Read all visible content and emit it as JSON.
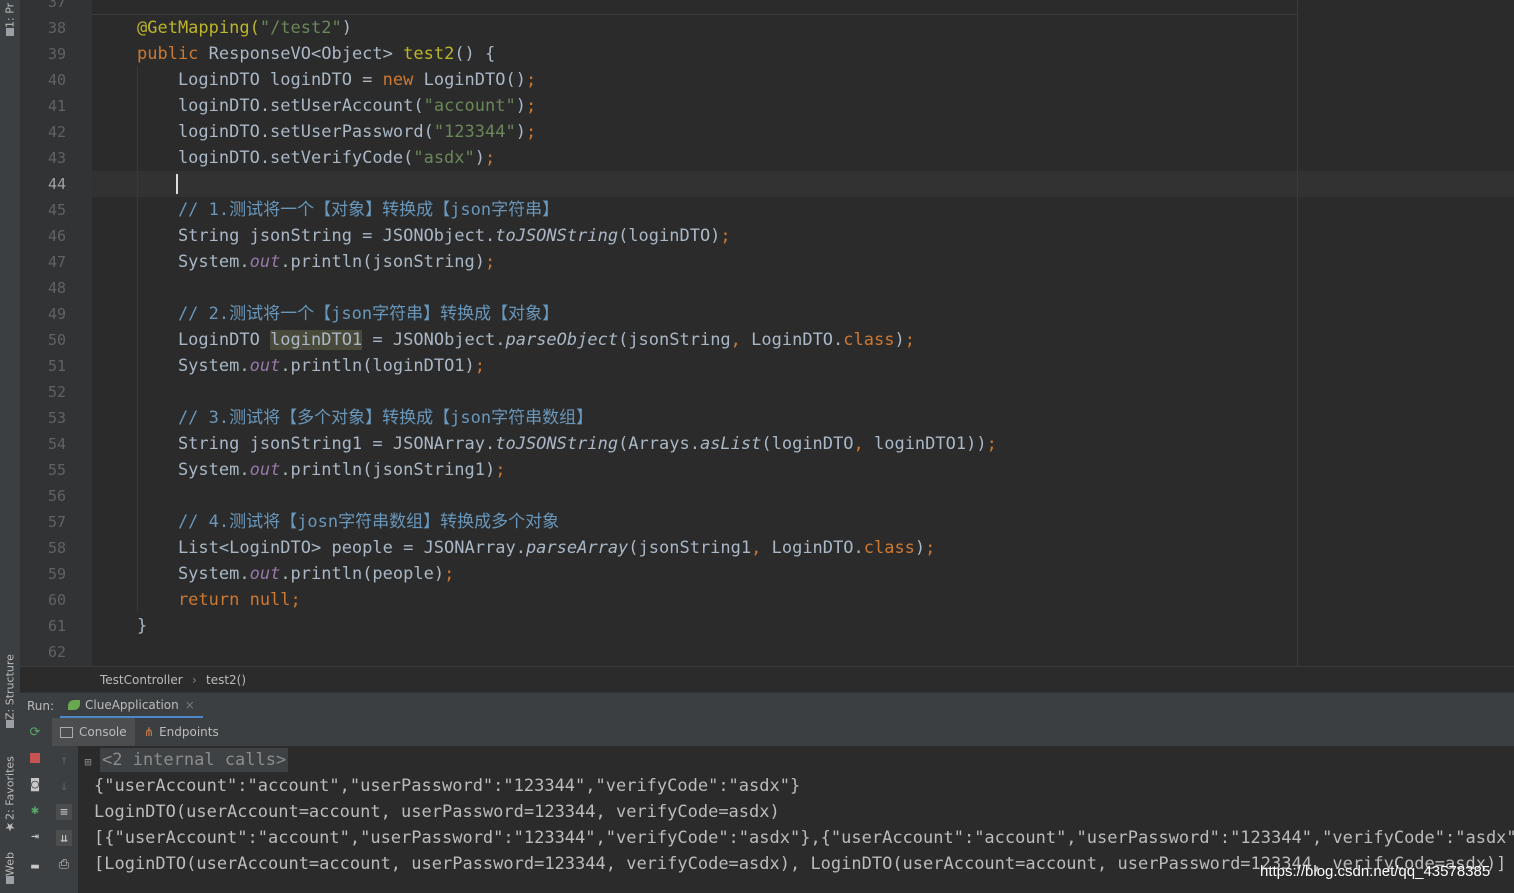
{
  "left_strip": {
    "project_tab": "1: Pr",
    "structure_tab": "Z: Structure",
    "favorites_tab": "2: Favorites",
    "web_tab": "Web"
  },
  "editor": {
    "first_line_number": 37,
    "current_line": 44,
    "line_numbers": [
      "37",
      "38",
      "39",
      "40",
      "41",
      "42",
      "43",
      "44",
      "45",
      "46",
      "47",
      "48",
      "49",
      "50",
      "51",
      "52",
      "53",
      "54",
      "55",
      "56",
      "57",
      "58",
      "59",
      "60",
      "61",
      "62"
    ],
    "code": {
      "l38": {
        "a": "@GetMapping(",
        "b": "\"/test2\"",
        "c": ")"
      },
      "l39": {
        "a": "public ",
        "b": "ResponseVO<Object> ",
        "c": "test2",
        "d": "() {"
      },
      "l40": {
        "a": "    LoginDTO loginDTO = ",
        "b": "new ",
        "c": "LoginDTO()",
        "d": ";"
      },
      "l41": {
        "a": "    loginDTO.setUserAccount(",
        "b": "\"account\"",
        "c": ")",
        "d": ";"
      },
      "l42": {
        "a": "    loginDTO.setUserPassword(",
        "b": "\"123344\"",
        "c": ")",
        "d": ";"
      },
      "l43": {
        "a": "    loginDTO.setVerifyCode(",
        "b": "\"asdx\"",
        "c": ")",
        "d": ";"
      },
      "l45": {
        "a": "    // 1.",
        "b": "测试将一个【对象】转换成【json字符串】"
      },
      "l46": {
        "a": "    String jsonString = JSONObject.",
        "b": "toJSONString",
        "c": "(loginDTO)",
        "d": ";"
      },
      "l47": {
        "a": "    System.",
        "b": "out",
        "c": ".println(jsonString)",
        "d": ";"
      },
      "l49": {
        "a": "    // 2.",
        "b": "测试将一个【json字符串】转换成【对象】"
      },
      "l50": {
        "a": "    LoginDTO ",
        "b": "loginDTO1",
        "c": " = JSONObject.",
        "d": "parseObject",
        "e": "(jsonString",
        "f": ", ",
        "g": "LoginDTO.",
        "h": "class",
        "i": ")",
        "j": ";"
      },
      "l51": {
        "a": "    System.",
        "b": "out",
        "c": ".println(loginDTO1)",
        "d": ";"
      },
      "l53": {
        "a": "    // 3.",
        "b": "测试将【多个对象】转换成【json字符串数组】"
      },
      "l54": {
        "a": "    String jsonString1 = JSONArray.",
        "b": "toJSONString",
        "c": "(Arrays.",
        "d": "asList",
        "e": "(loginDTO",
        "f": ", ",
        "g": "loginDTO1))",
        "h": ";"
      },
      "l55": {
        "a": "    System.",
        "b": "out",
        "c": ".println(jsonString1)",
        "d": ";"
      },
      "l57": {
        "a": "    // 4.",
        "b": "测试将【josn字符串数组】转换成多个对象"
      },
      "l58": {
        "a": "    List<LoginDTO> people = JSONArray.",
        "b": "parseArray",
        "c": "(jsonString1",
        "d": ", ",
        "e": "LoginDTO.",
        "f": "class",
        "g": ")",
        "h": ";"
      },
      "l59": {
        "a": "    System.",
        "b": "out",
        "c": ".println(people)",
        "d": ";"
      },
      "l60": {
        "a": "    return null",
        "b": ";"
      },
      "l61": {
        "a": "}"
      }
    }
  },
  "breadcrumb": {
    "class_name": "TestController",
    "separator": "›",
    "method": "test2()"
  },
  "run_panel": {
    "label": "Run:",
    "config_tab": "ClueApplication",
    "close_glyph": "×",
    "tabs": {
      "console": "Console",
      "endpoints": "Endpoints"
    }
  },
  "console": {
    "internal_calls": "<2 internal calls>",
    "lines": [
      "{\"userAccount\":\"account\",\"userPassword\":\"123344\",\"verifyCode\":\"asdx\"}",
      "LoginDTO(userAccount=account, userPassword=123344, verifyCode=asdx)",
      "[{\"userAccount\":\"account\",\"userPassword\":\"123344\",\"verifyCode\":\"asdx\"},{\"userAccount\":\"account\",\"userPassword\":\"123344\",\"verifyCode\":\"asdx\"}]",
      "[LoginDTO(userAccount=account, userPassword=123344, verifyCode=asdx), LoginDTO(userAccount=account, userPassword=123344, verifyCode=asdx)]"
    ]
  },
  "watermark": "https://blog.csdn.net/qq_43578385",
  "icons": [
    "rerun-icon",
    "stop-icon",
    "camera-icon",
    "settings-icon",
    "login-icon",
    "layout-icon",
    "up-arrow-icon",
    "down-arrow-icon",
    "soft-wrap-icon",
    "scroll-end-icon",
    "print-icon",
    "expand-icon",
    "leaf-icon",
    "star-icon"
  ],
  "colors": {
    "keyword": "#cc7832",
    "string": "#6a8759",
    "annotation": "#bbb529",
    "comment": "#629755",
    "field": "#9876aa",
    "text": "#a9b7c6",
    "background": "#2b2b2b"
  }
}
